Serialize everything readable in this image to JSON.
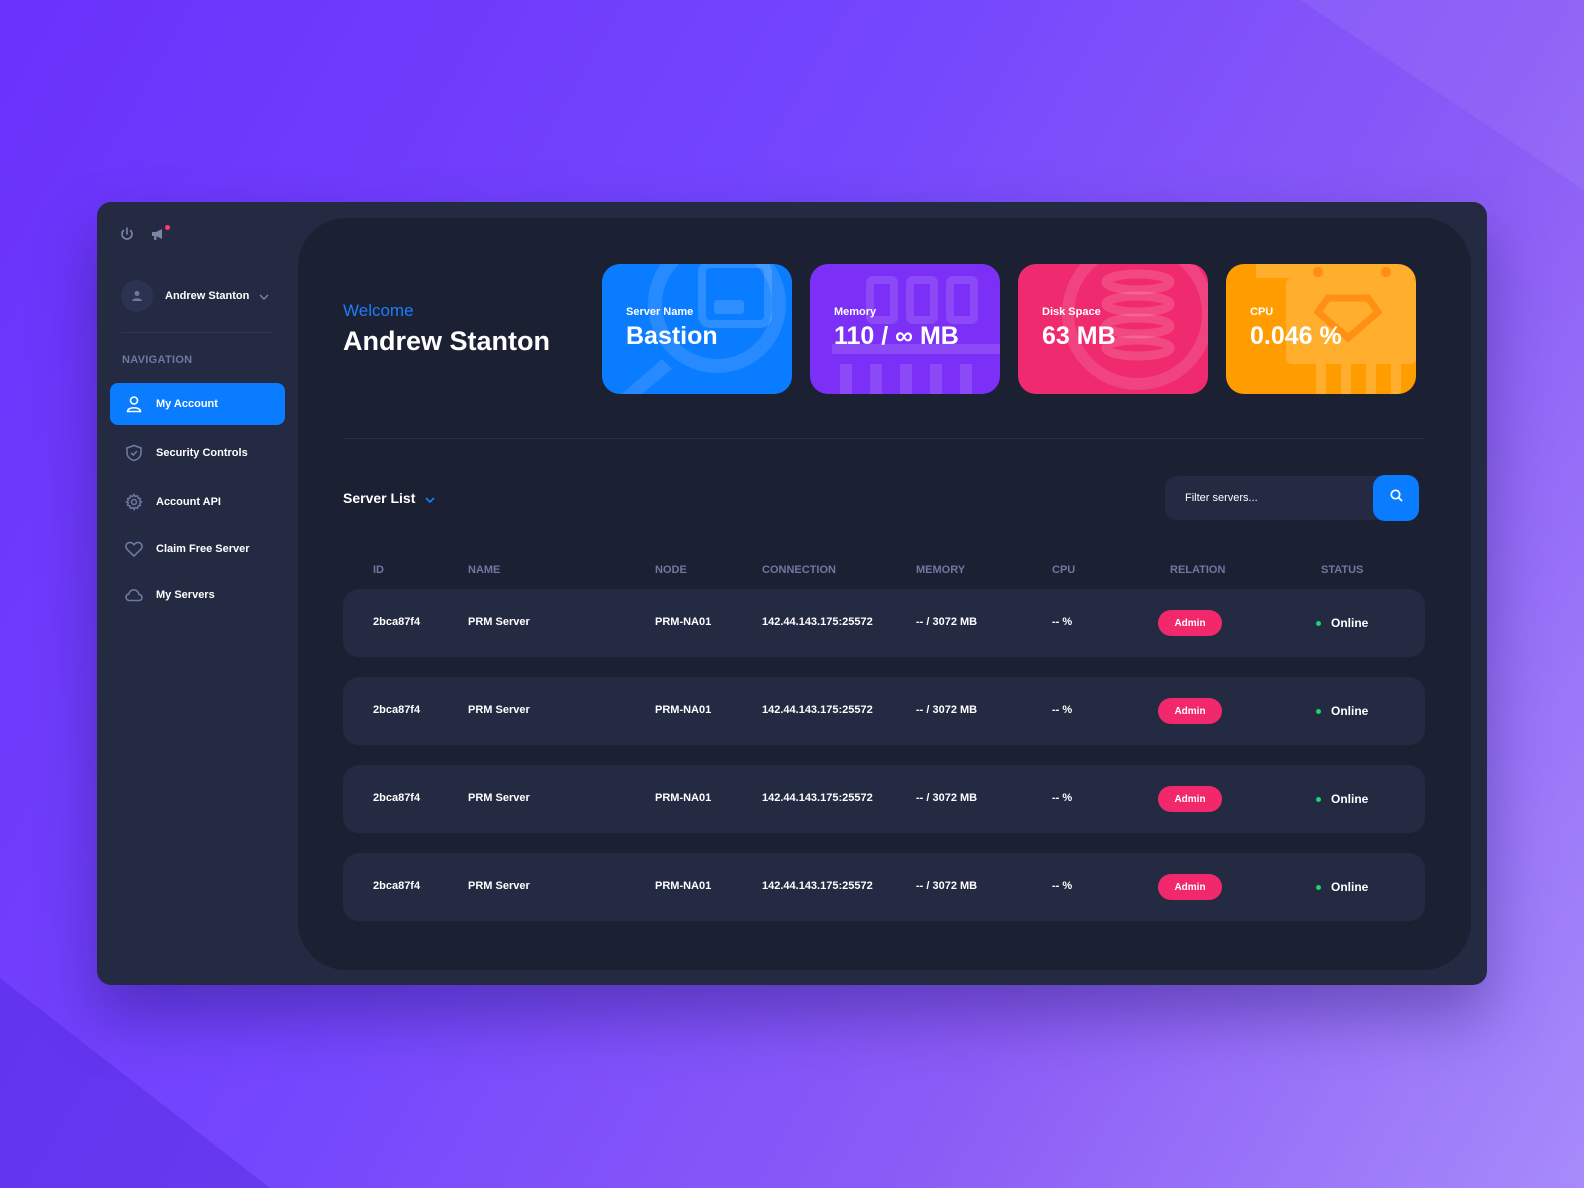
{
  "sidebar": {
    "user_name": "Andrew Stanton",
    "nav_title": "NAVIGATION",
    "items": [
      {
        "label": "My Account",
        "icon": "user-icon",
        "active": true
      },
      {
        "label": "Security Controls",
        "icon": "shield-icon"
      },
      {
        "label": "Account API",
        "icon": "gear-icon"
      },
      {
        "label": "Claim Free Server",
        "icon": "heart-icon"
      },
      {
        "label": "My Servers",
        "icon": "cloud-icon"
      }
    ]
  },
  "header": {
    "welcome": "Welcome",
    "name": "Andrew Stanton"
  },
  "cards": [
    {
      "label": "Server Name",
      "value": "Bastion",
      "color": "#0a7cff"
    },
    {
      "label": "Memory",
      "value": "110 / ∞ MB",
      "color": "#7b2ff7"
    },
    {
      "label": "Disk Space",
      "value": "63 MB",
      "color": "#f02a6e"
    },
    {
      "label": "CPU",
      "value": "0.046 %",
      "color": "#ff9d00"
    }
  ],
  "server_list": {
    "title": "Server List",
    "filter_placeholder": "Filter servers...",
    "columns": [
      "ID",
      "NAME",
      "NODE",
      "CONNECTION",
      "MEMORY",
      "CPU",
      "RELATION",
      "STATUS"
    ],
    "rows": [
      {
        "id": "2bca87f4",
        "name": "PRM Server",
        "node": "PRM-NA01",
        "connection": "142.44.143.175:25572",
        "memory": "-- / 3072 MB",
        "cpu": "-- %",
        "relation": "Admin",
        "status": "Online"
      },
      {
        "id": "2bca87f4",
        "name": "PRM Server",
        "node": "PRM-NA01",
        "connection": "142.44.143.175:25572",
        "memory": "-- / 3072 MB",
        "cpu": "-- %",
        "relation": "Admin",
        "status": "Online"
      },
      {
        "id": "2bca87f4",
        "name": "PRM Server",
        "node": "PRM-NA01",
        "connection": "142.44.143.175:25572",
        "memory": "-- / 3072 MB",
        "cpu": "-- %",
        "relation": "Admin",
        "status": "Online"
      },
      {
        "id": "2bca87f4",
        "name": "PRM Server",
        "node": "PRM-NA01",
        "connection": "142.44.143.175:25572",
        "memory": "-- / 3072 MB",
        "cpu": "-- %",
        "relation": "Admin",
        "status": "Online"
      }
    ]
  },
  "colors": {
    "accent": "#0a7cff",
    "badge": "#f2286d",
    "online": "#19d66b"
  }
}
